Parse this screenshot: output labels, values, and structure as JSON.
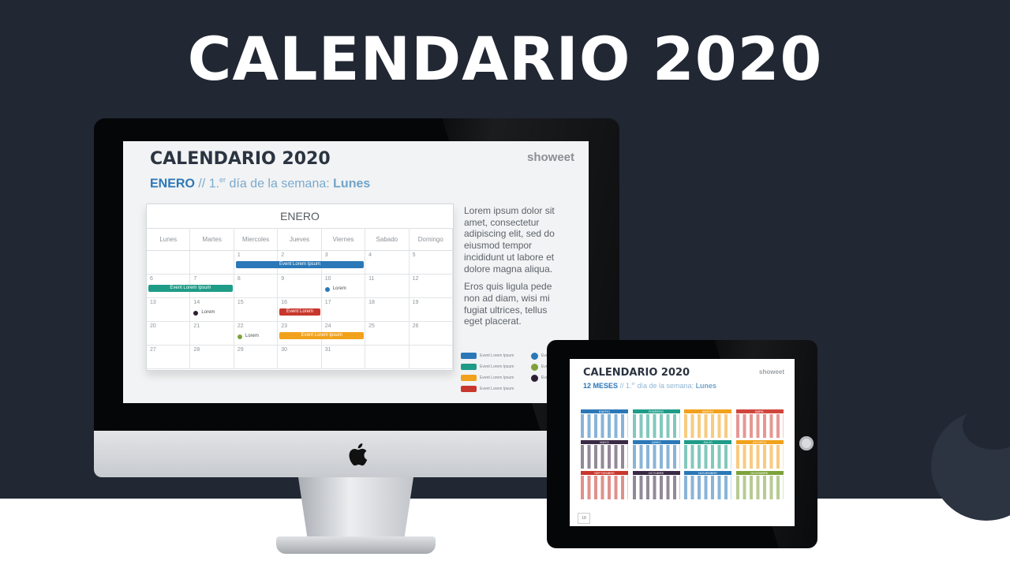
{
  "page": {
    "title": "CALENDARIO 2020"
  },
  "slide": {
    "title": "CALENDARIO 2020",
    "subtitle_month": "ENERO",
    "subtitle_sep": " // 1.",
    "subtitle_sup": "er",
    "subtitle_text": " día de la semana: ",
    "subtitle_day": "Lunes",
    "brand": "showeet",
    "calendar": {
      "month": "ENERO",
      "weekdays": [
        "Lunes",
        "Martes",
        "Miercoles",
        "Jueves",
        "Viernes",
        "Sabado",
        "Domingo"
      ],
      "weeks": [
        [
          "",
          "",
          "1",
          "2",
          "3",
          "4",
          "5"
        ],
        [
          "6",
          "7",
          "8",
          "9",
          "10",
          "11",
          "12"
        ],
        [
          "13",
          "14",
          "15",
          "16",
          "17",
          "18",
          "19"
        ],
        [
          "20",
          "21",
          "22",
          "23",
          "24",
          "25",
          "26"
        ],
        [
          "27",
          "28",
          "29",
          "30",
          "31",
          "",
          ""
        ]
      ],
      "events": [
        {
          "label": "Event Lorem Ipsum",
          "color": "#2a78b7"
        },
        {
          "label": "Event Lorem Ipsum",
          "color": "#1f9c88"
        },
        {
          "label": "Event Lorem Ipsum",
          "color": "#c8372d"
        },
        {
          "label": "Event Lorem Ipsum",
          "color": "#f1a11b"
        }
      ],
      "dots": [
        {
          "label": "Lorem",
          "color": "#2a78b7"
        },
        {
          "label": "Lorem",
          "color": "#2d1f33"
        },
        {
          "label": "Lorem",
          "color": "#7da23a"
        }
      ]
    },
    "body_paragraphs": [
      "Lorem ipsum dolor sit amet, consectetur adipiscing elit, sed do eiusmod tempor incididunt ut labore et dolore magna aliqua.",
      "Eros quis ligula pede non ad diam, wisi mi fugiat ultrices, tellus eget placerat."
    ],
    "legend_bars": [
      {
        "label": "Event Lorem Ipsum",
        "color": "#2a78b7"
      },
      {
        "label": "Event Lorem Ipsum",
        "color": "#1f9c88"
      },
      {
        "label": "Event Lorem Ipsum",
        "color": "#f1a11b"
      },
      {
        "label": "Event Lorem Ipsum",
        "color": "#c8372d"
      }
    ],
    "legend_dots": [
      {
        "label": "Event Lorem Ipsum",
        "color": "#2a78b7"
      },
      {
        "label": "Event Lorem Ipsum",
        "color": "#7da23a"
      },
      {
        "label": "Event Lorem Ipsum",
        "color": "#2d1f33"
      }
    ]
  },
  "tablet": {
    "title": "CALENDARIO 2020",
    "subtitle_months": "12 MESES",
    "subtitle_sep": " // 1.",
    "subtitle_sup": "er",
    "subtitle_text": " día de la semana: ",
    "subtitle_day": "Lunes",
    "brand": "showeet",
    "page_number": "18",
    "months": [
      {
        "name": "ENERO",
        "color": "#2a78b7"
      },
      {
        "name": "FEBRERO",
        "color": "#1f9c88"
      },
      {
        "name": "MARZO",
        "color": "#f1a11b"
      },
      {
        "name": "ABRIL",
        "color": "#d0453c"
      },
      {
        "name": "MAYO",
        "color": "#3a2a45"
      },
      {
        "name": "JUNIO",
        "color": "#2a78b7"
      },
      {
        "name": "JULIO",
        "color": "#1f9c88"
      },
      {
        "name": "AGOSTO",
        "color": "#f1a11b"
      },
      {
        "name": "SEPTIEMBRE",
        "color": "#c8372d"
      },
      {
        "name": "OCTUBRE",
        "color": "#3a2a45"
      },
      {
        "name": "NOVIEMBRE",
        "color": "#2a78b7"
      },
      {
        "name": "DICIEMBRE",
        "color": "#7da23a"
      }
    ]
  }
}
